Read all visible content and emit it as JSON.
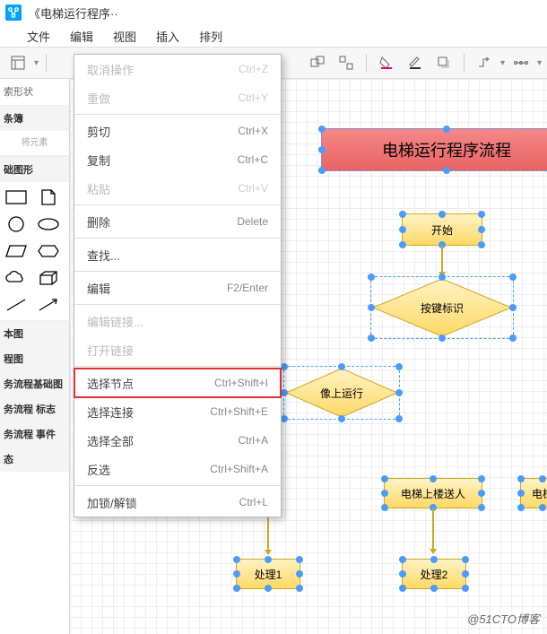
{
  "title": "《电梯运行程序··",
  "menubar": [
    "文件",
    "编辑",
    "视图",
    "插入",
    "排列"
  ],
  "sidebar": {
    "search": "索形状",
    "group1": "条簿",
    "drop": "将元素",
    "group2": "础图形",
    "cats": [
      "本图",
      "程图",
      "务流程基础图",
      "务流程 标志",
      "务流程 事件",
      "态"
    ]
  },
  "context": [
    {
      "label": "取消操作",
      "sc": "Ctrl+Z",
      "disabled": true
    },
    {
      "label": "重做",
      "sc": "Ctrl+Y",
      "disabled": true
    },
    {
      "sep": true
    },
    {
      "label": "剪切",
      "sc": "Ctrl+X"
    },
    {
      "label": "复制",
      "sc": "Ctrl+C"
    },
    {
      "label": "粘贴",
      "sc": "Ctrl+V",
      "disabled": true
    },
    {
      "sep": true
    },
    {
      "label": "删除",
      "sc": "Delete"
    },
    {
      "sep": true
    },
    {
      "label": "查找...",
      "sc": ""
    },
    {
      "sep": true
    },
    {
      "label": "编辑",
      "sc": "F2/Enter"
    },
    {
      "sep": true
    },
    {
      "label": "编辑链接...",
      "sc": "",
      "disabled": true
    },
    {
      "label": "打开链接",
      "sc": "",
      "disabled": true
    },
    {
      "sep": true
    },
    {
      "label": "选择节点",
      "sc": "Ctrl+Shift+I",
      "hl": true
    },
    {
      "label": "选择连接",
      "sc": "Ctrl+Shift+E"
    },
    {
      "label": "选择全部",
      "sc": "Ctrl+A"
    },
    {
      "label": "反选",
      "sc": "Ctrl+Shift+A"
    },
    {
      "sep": true
    },
    {
      "label": "加锁/解锁",
      "sc": "Ctrl+L"
    }
  ],
  "nodes": {
    "title": "电梯运行程序流程",
    "start": "开始",
    "key": "按键标识",
    "up": "像上运行",
    "elev_up": "电梯上楼送人",
    "elev2": "电梯",
    "p1": "处理1",
    "p2": "处理2"
  },
  "watermark": "@51CTO博客"
}
